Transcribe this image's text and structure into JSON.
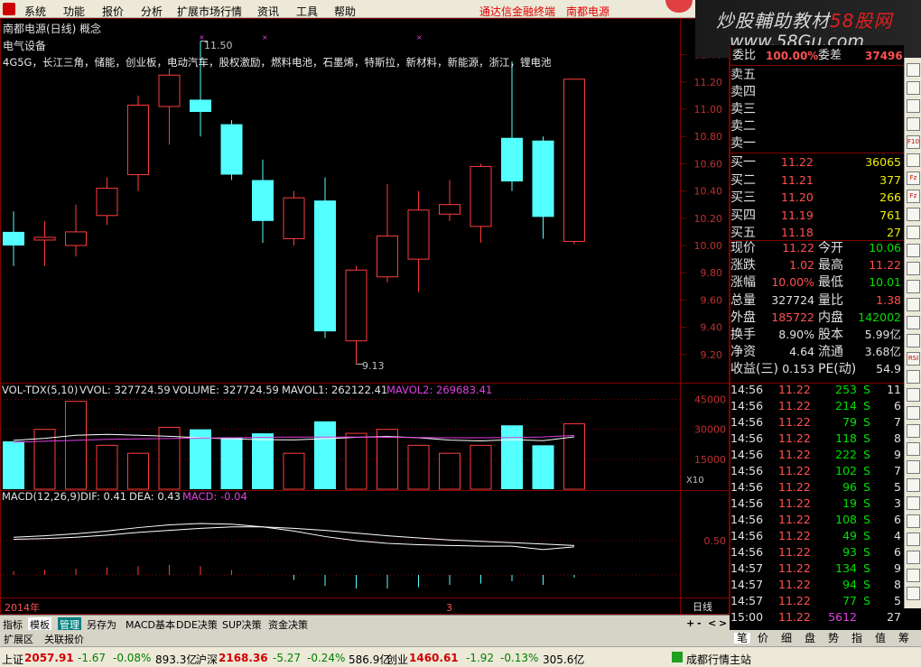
{
  "menubar": {
    "items": [
      "系统",
      "功能",
      "报价",
      "分析",
      "扩展市场行情",
      "资讯",
      "工具",
      "帮助"
    ],
    "links": [
      "通达信金融终端",
      "南都电源"
    ]
  },
  "watermark": {
    "name_a": "炒股輔助教材",
    "name_b": "58股网",
    "url": "www.58Gu.com"
  },
  "chart_header": {
    "title": "南都电源(日线) 概念",
    "industry": "电气设备",
    "concepts": "4G5G，长江三角，储能，创业板，电动汽车，股权激励，燃料电池，石墨烯，特斯拉，新材料，新能源，浙江，锂电池",
    "high_marker": "11.50",
    "low_marker": "9.13"
  },
  "price_axis": [
    "11.40",
    "11.20",
    "11.00",
    "10.80",
    "10.60",
    "10.40",
    "10.20",
    "10.00",
    "9.80",
    "9.60",
    "9.40",
    "9.20"
  ],
  "vol_header": {
    "label": "VOL-TDX(5,10)",
    "vvol": "VVOL: 327724.59",
    "volume": "VOLUME: 327724.59",
    "mavol1": "MAVOL1: 262122.41",
    "mavol2": "MAVOL2: 269683.41"
  },
  "vol_axis": [
    "45000",
    "30000",
    "15000"
  ],
  "vol_unit": "X10",
  "macd_header": {
    "label": "MACD(12,26,9)",
    "dif": "DIF: 0.41",
    "dea": "DEA: 0.43",
    "macd": "MACD: -0.04"
  },
  "macd_axis": [
    "0.50"
  ],
  "date_axis": {
    "year": "2014年",
    "month": "3",
    "period": "日线"
  },
  "chart_data": {
    "type": "candlestick",
    "candles": [
      {
        "o": 10.1,
        "c": 10.0,
        "h": 10.25,
        "l": 9.85
      },
      {
        "o": 10.04,
        "c": 10.06,
        "h": 10.18,
        "l": 9.85
      },
      {
        "o": 10.0,
        "c": 10.1,
        "h": 10.3,
        "l": 9.92
      },
      {
        "o": 10.22,
        "c": 10.42,
        "h": 10.5,
        "l": 10.15
      },
      {
        "o": 10.52,
        "c": 11.03,
        "h": 11.1,
        "l": 10.4
      },
      {
        "o": 11.02,
        "c": 11.25,
        "h": 11.3,
        "l": 10.74
      },
      {
        "o": 11.07,
        "c": 10.98,
        "h": 11.5,
        "l": 10.8
      },
      {
        "o": 10.89,
        "c": 10.52,
        "h": 10.92,
        "l": 10.48
      },
      {
        "o": 10.48,
        "c": 10.18,
        "h": 10.63,
        "l": 10.02
      },
      {
        "o": 10.05,
        "c": 10.35,
        "h": 10.4,
        "l": 10.0
      },
      {
        "o": 10.33,
        "c": 9.37,
        "h": 10.5,
        "l": 9.32
      },
      {
        "o": 9.3,
        "c": 9.82,
        "h": 9.85,
        "l": 9.13
      },
      {
        "o": 9.77,
        "c": 10.07,
        "h": 10.45,
        "l": 9.73
      },
      {
        "o": 9.9,
        "c": 10.26,
        "h": 10.4,
        "l": 9.66
      },
      {
        "o": 10.23,
        "c": 10.3,
        "h": 10.48,
        "l": 10.18
      },
      {
        "o": 10.14,
        "c": 10.58,
        "h": 10.6,
        "l": 10.02
      },
      {
        "o": 10.79,
        "c": 10.47,
        "h": 11.35,
        "l": 10.4
      },
      {
        "o": 10.77,
        "c": 10.21,
        "h": 10.8,
        "l": 10.05
      },
      {
        "o": 10.03,
        "c": 11.22,
        "h": 11.22,
        "l": 10.01
      }
    ],
    "volume": [
      24000,
      30000,
      44000,
      22000,
      18000,
      31000,
      30000,
      26000,
      28000,
      18000,
      34000,
      28000,
      30000,
      22000,
      18000,
      22000,
      32000,
      22000,
      32772
    ],
    "mavol1": [
      24500,
      25500,
      27000,
      27500,
      27000,
      26500,
      25800,
      25200,
      24800,
      24700,
      25300,
      26000,
      26400,
      25800,
      24600,
      24200,
      24800,
      24300,
      26212
    ],
    "mavol2": [
      23500,
      24000,
      24500,
      25000,
      25200,
      25400,
      25600,
      25800,
      26000,
      26100,
      26100,
      26100,
      26000,
      25900,
      25800,
      25800,
      25900,
      26200,
      26968
    ],
    "dif": [
      0.55,
      0.57,
      0.6,
      0.64,
      0.69,
      0.73,
      0.75,
      0.74,
      0.7,
      0.64,
      0.56,
      0.5,
      0.46,
      0.44,
      0.43,
      0.42,
      0.42,
      0.37,
      0.41
    ],
    "dea": [
      0.52,
      0.53,
      0.55,
      0.58,
      0.62,
      0.65,
      0.68,
      0.7,
      0.7,
      0.68,
      0.65,
      0.61,
      0.57,
      0.54,
      0.51,
      0.49,
      0.47,
      0.45,
      0.43
    ]
  },
  "quote": {
    "weibi_label": "委比",
    "weibi": "100.00%",
    "weicha_label": "委差",
    "weicha": "37496",
    "sell_labels": [
      "卖五",
      "卖四",
      "卖三",
      "卖二",
      "卖一"
    ],
    "buys": [
      {
        "label": "买一",
        "price": "11.22",
        "vol": "36065"
      },
      {
        "label": "买二",
        "price": "11.21",
        "vol": "377"
      },
      {
        "label": "买三",
        "price": "11.20",
        "vol": "266"
      },
      {
        "label": "买四",
        "price": "11.19",
        "vol": "761"
      },
      {
        "label": "买五",
        "price": "11.18",
        "vol": "27"
      }
    ],
    "stats": [
      {
        "l1": "现价",
        "v1": "11.22",
        "c1": "#ff5050",
        "l2": "今开",
        "v2": "10.06",
        "c2": "#00e000"
      },
      {
        "l1": "涨跌",
        "v1": "1.02",
        "c1": "#ff5050",
        "l2": "最高",
        "v2": "11.22",
        "c2": "#ff5050"
      },
      {
        "l1": "涨幅",
        "v1": "10.00%",
        "c1": "#ff5050",
        "l2": "最低",
        "v2": "10.01",
        "c2": "#00e000"
      },
      {
        "l1": "总量",
        "v1": "327724",
        "c1": "#e0e0e0",
        "l2": "量比",
        "v2": "1.38",
        "c2": "#ff5050"
      },
      {
        "l1": "外盘",
        "v1": "185722",
        "c1": "#ff5050",
        "l2": "内盘",
        "v2": "142002",
        "c2": "#00e000"
      },
      {
        "l1": "换手",
        "v1": "8.90%",
        "c1": "#e0e0e0",
        "l2": "股本",
        "v2": "5.99亿",
        "c2": "#e0e0e0"
      },
      {
        "l1": "净资",
        "v1": "4.64",
        "c1": "#e0e0e0",
        "l2": "流通",
        "v2": "3.68亿",
        "c2": "#e0e0e0"
      },
      {
        "l1": "收益(三)",
        "v1": "0.153",
        "c1": "#e0e0e0",
        "l2": "PE(动)",
        "v2": "54.9",
        "c2": "#e0e0e0"
      }
    ]
  },
  "ticks": [
    {
      "t": "14:56",
      "p": "11.22",
      "v": "253",
      "s": "S",
      "n": "11"
    },
    {
      "t": "14:56",
      "p": "11.22",
      "v": "214",
      "s": "S",
      "n": "6"
    },
    {
      "t": "14:56",
      "p": "11.22",
      "v": "79",
      "s": "S",
      "n": "7"
    },
    {
      "t": "14:56",
      "p": "11.22",
      "v": "118",
      "s": "S",
      "n": "8"
    },
    {
      "t": "14:56",
      "p": "11.22",
      "v": "222",
      "s": "S",
      "n": "9"
    },
    {
      "t": "14:56",
      "p": "11.22",
      "v": "102",
      "s": "S",
      "n": "7"
    },
    {
      "t": "14:56",
      "p": "11.22",
      "v": "96",
      "s": "S",
      "n": "5"
    },
    {
      "t": "14:56",
      "p": "11.22",
      "v": "19",
      "s": "S",
      "n": "3"
    },
    {
      "t": "14:56",
      "p": "11.22",
      "v": "108",
      "s": "S",
      "n": "6"
    },
    {
      "t": "14:56",
      "p": "11.22",
      "v": "49",
      "s": "S",
      "n": "4"
    },
    {
      "t": "14:56",
      "p": "11.22",
      "v": "93",
      "s": "S",
      "n": "6"
    },
    {
      "t": "14:57",
      "p": "11.22",
      "v": "134",
      "s": "S",
      "n": "9"
    },
    {
      "t": "14:57",
      "p": "11.22",
      "v": "94",
      "s": "S",
      "n": "8"
    },
    {
      "t": "14:57",
      "p": "11.22",
      "v": "77",
      "s": "S",
      "n": "5"
    },
    {
      "t": "15:00",
      "p": "11.22",
      "v": "5612",
      "s": "",
      "n": "27"
    }
  ],
  "right_tabs": [
    "笔",
    "价",
    "细",
    "盘",
    "势",
    "指",
    "值",
    "筹"
  ],
  "right_bar": [
    "F10",
    "Fz",
    "Fz",
    "RSI"
  ],
  "bottom_tabs": [
    "指标",
    "模板",
    "管理",
    "另存为",
    "MACD基本",
    "DDE决策",
    "SUP决策",
    "资金决策"
  ],
  "bottom_tabs_small": [
    "+",
    "-",
    "<",
    ">"
  ],
  "ext_tabs": [
    "扩展区",
    "关联报价"
  ],
  "statusbar": {
    "sh_label": "上证",
    "sh_val": "2057.91",
    "sh_chg": "-1.67",
    "sh_pct": "-0.08%",
    "sh_amt": "893.3亿",
    "sz_label": "沪深",
    "sz_val": "2168.36",
    "sz_chg": "-5.27",
    "sz_pct": "-0.24%",
    "sz_amt": "586.9亿",
    "cy_label": "创业",
    "cy_val": "1460.61",
    "cy_chg": "-1.92",
    "cy_pct": "-0.13%",
    "cy_amt": "305.6亿",
    "server": "成都行情主站"
  },
  "colors": {
    "up": "#ff3c3c",
    "down": "#54ffff",
    "grid": "#800000",
    "macd": "#e040e0"
  }
}
